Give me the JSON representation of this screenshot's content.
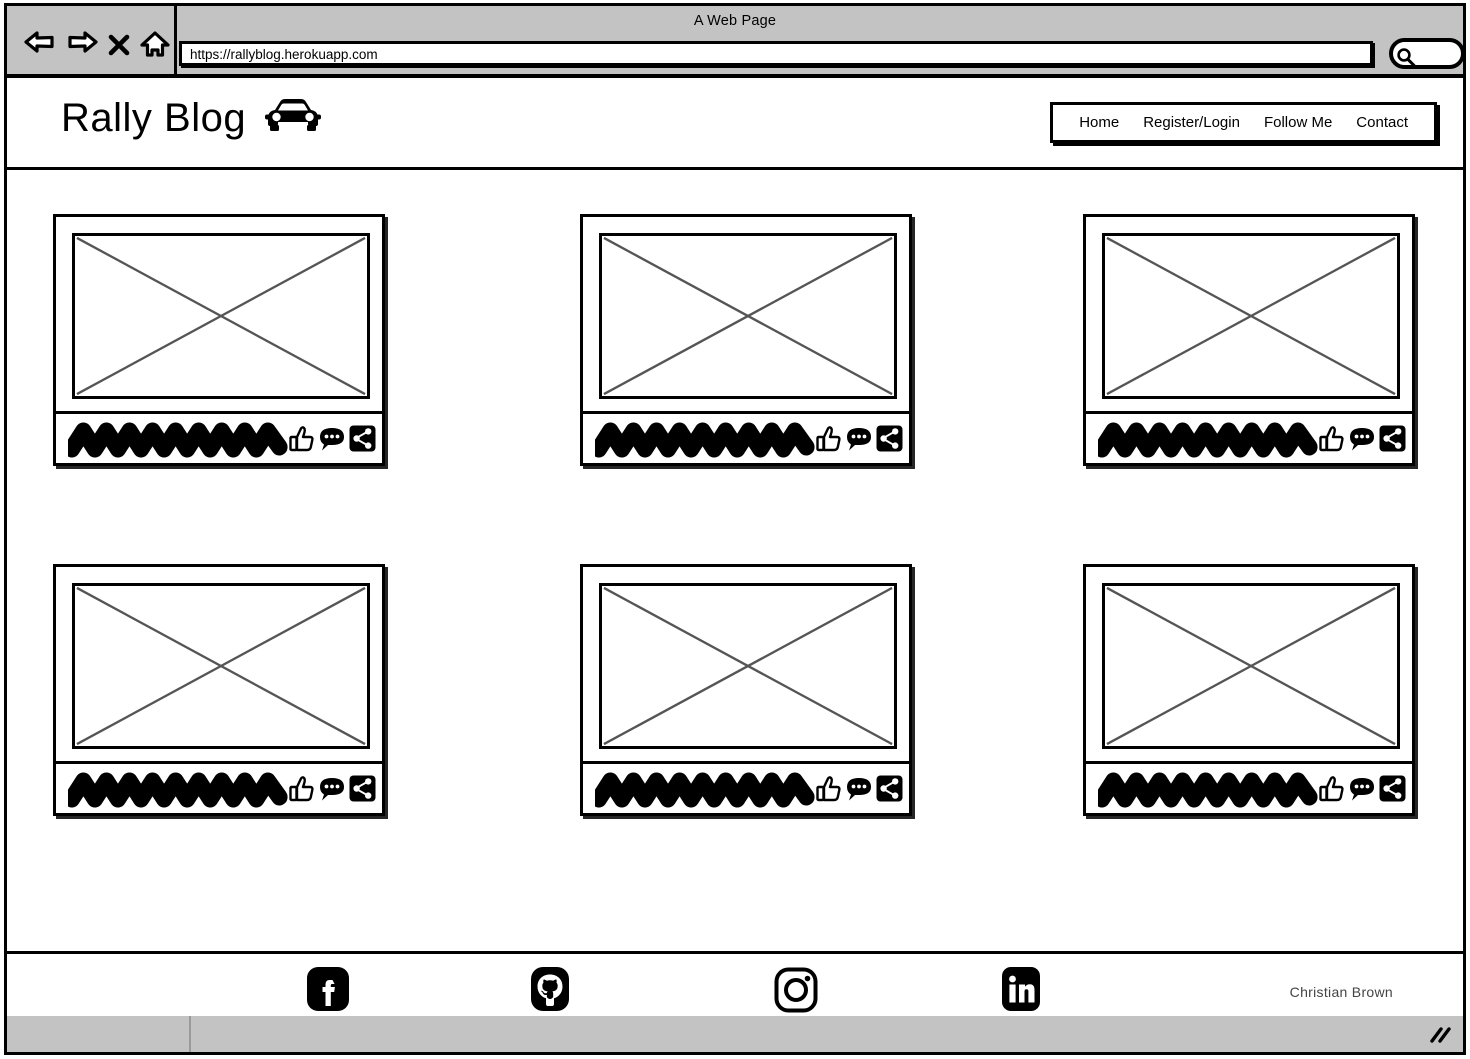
{
  "browser": {
    "window_title": "A Web Page",
    "url": "https://rallyblog.herokuapp.com",
    "controls": [
      {
        "name": "back-arrow-icon",
        "label": "Back"
      },
      {
        "name": "forward-arrow-icon",
        "label": "Forward"
      },
      {
        "name": "stop-x-icon",
        "label": "Stop"
      },
      {
        "name": "home-icon",
        "label": "Home"
      }
    ],
    "search_icon": "search-icon",
    "status_bar": {
      "resize_grip_icon": "resize-grip-icon"
    }
  },
  "site": {
    "brand": {
      "title": "Rally Blog",
      "logo_icon": "car-icon"
    },
    "nav": [
      {
        "label": "Home"
      },
      {
        "label": "Register/Login"
      },
      {
        "label": "Follow Me"
      },
      {
        "label": "Contact"
      }
    ]
  },
  "cards": [
    {
      "media_placeholder": "image-placeholder",
      "caption": "scribble-placeholder-text",
      "actions": [
        {
          "icon": "thumbs-up-icon",
          "label": "Like"
        },
        {
          "icon": "comment-icon",
          "label": "Comment"
        },
        {
          "icon": "share-icon",
          "label": "Share"
        }
      ]
    },
    {
      "media_placeholder": "image-placeholder",
      "caption": "scribble-placeholder-text",
      "actions": [
        {
          "icon": "thumbs-up-icon",
          "label": "Like"
        },
        {
          "icon": "comment-icon",
          "label": "Comment"
        },
        {
          "icon": "share-icon",
          "label": "Share"
        }
      ]
    },
    {
      "media_placeholder": "image-placeholder",
      "caption": "scribble-placeholder-text",
      "actions": [
        {
          "icon": "thumbs-up-icon",
          "label": "Like"
        },
        {
          "icon": "comment-icon",
          "label": "Comment"
        },
        {
          "icon": "share-icon",
          "label": "Share"
        }
      ]
    },
    {
      "media_placeholder": "image-placeholder",
      "caption": "scribble-placeholder-text",
      "actions": [
        {
          "icon": "thumbs-up-icon",
          "label": "Like"
        },
        {
          "icon": "comment-icon",
          "label": "Comment"
        },
        {
          "icon": "share-icon",
          "label": "Share"
        }
      ]
    },
    {
      "media_placeholder": "image-placeholder",
      "caption": "scribble-placeholder-text",
      "actions": [
        {
          "icon": "thumbs-up-icon",
          "label": "Like"
        },
        {
          "icon": "comment-icon",
          "label": "Comment"
        },
        {
          "icon": "share-icon",
          "label": "Share"
        }
      ]
    },
    {
      "media_placeholder": "image-placeholder",
      "caption": "scribble-placeholder-text",
      "actions": [
        {
          "icon": "thumbs-up-icon",
          "label": "Like"
        },
        {
          "icon": "comment-icon",
          "label": "Comment"
        },
        {
          "icon": "share-icon",
          "label": "Share"
        }
      ]
    }
  ],
  "footer": {
    "social": [
      {
        "icon": "facebook-icon",
        "label": "Facebook"
      },
      {
        "icon": "github-icon",
        "label": "GitHub"
      },
      {
        "icon": "instagram-icon",
        "label": "Instagram"
      },
      {
        "icon": "linkedin-icon",
        "label": "LinkedIn"
      }
    ],
    "credit": "Christian Brown"
  },
  "colors": {
    "chrome": "#c3c3c3",
    "ink": "#000000",
    "paper": "#ffffff",
    "placeholder_cross": "#555555",
    "credit_text": "#444444"
  }
}
